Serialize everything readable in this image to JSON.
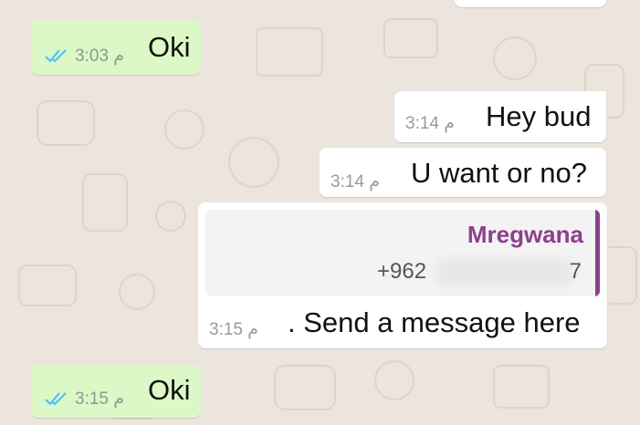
{
  "messages": [
    {
      "kind": "outgoing",
      "text": "Oki",
      "time": "3:03 م",
      "status": "read"
    },
    {
      "kind": "incoming",
      "text": "Hey bud",
      "time": "3:14 م"
    },
    {
      "kind": "incoming",
      "text": "U want or no?",
      "time": "3:14 م"
    },
    {
      "kind": "incoming",
      "quote": {
        "name": "Mregwana",
        "phone_prefix": "+962",
        "phone_end": "7"
      },
      "text": ". Send a message here",
      "time": "3:15 م"
    },
    {
      "kind": "outgoing",
      "text": "Oki",
      "time": "3:15 م",
      "status": "read"
    }
  ],
  "colors": {
    "background": "#ece5dd",
    "outgoing_bubble": "#dcf8c6",
    "incoming_bubble": "#ffffff",
    "read_ticks": "#4fc3f7",
    "quote_accent": "#8e3f8e"
  },
  "icons": {
    "read_receipt": "double-check-icon"
  }
}
